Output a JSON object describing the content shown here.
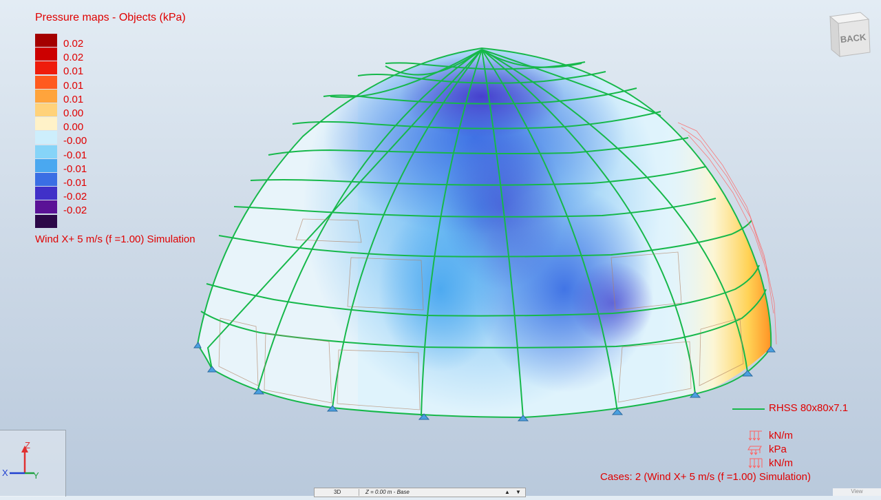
{
  "legend": {
    "title": "Pressure maps - Objects (kPa)",
    "entries": [
      {
        "label": "0.02",
        "color": "#a40000"
      },
      {
        "label": "0.02",
        "color": "#cc0000"
      },
      {
        "label": "0.01",
        "color": "#ee1c0c"
      },
      {
        "label": "0.01",
        "color": "#ff5a1e"
      },
      {
        "label": "0.01",
        "color": "#ffa43c"
      },
      {
        "label": "0.00",
        "color": "#ffd27a"
      },
      {
        "label": "0.00",
        "color": "#fff2c8"
      },
      {
        "label": "-0.00",
        "color": "#cdeefc"
      },
      {
        "label": "-0.01",
        "color": "#86d4f8"
      },
      {
        "label": "-0.01",
        "color": "#4aa8f0"
      },
      {
        "label": "-0.01",
        "color": "#3a6ee4"
      },
      {
        "label": "-0.02",
        "color": "#4030c8"
      },
      {
        "label": "-0.02",
        "color": "#5a1296"
      },
      {
        "label": "",
        "color": "#2c0848"
      }
    ],
    "case_label": "Wind X+ 5 m/s (f =1.00) Simulation"
  },
  "section": {
    "label": "RHSS 80x80x7.1",
    "color": "#16b84a"
  },
  "units": [
    {
      "icon": "distributed-load-icon",
      "label": "kN/m"
    },
    {
      "icon": "surface-load-icon",
      "label": "kPa"
    },
    {
      "icon": "distributed-load-icon",
      "label": "kN/m"
    }
  ],
  "cases": "Cases: 2 (Wind X+ 5 m/s (f =1.00) Simulation)",
  "view_cube": {
    "label": "BACK"
  },
  "axes": {
    "z": "Z",
    "x": "X",
    "y": "Y"
  },
  "statusbar": {
    "view": "3D",
    "level": "Z = 0.00 m - Base"
  },
  "corner": {
    "label": "View"
  },
  "colors": {
    "structure": "#16b84a",
    "text": "#e00000",
    "load": "#ff6060"
  }
}
